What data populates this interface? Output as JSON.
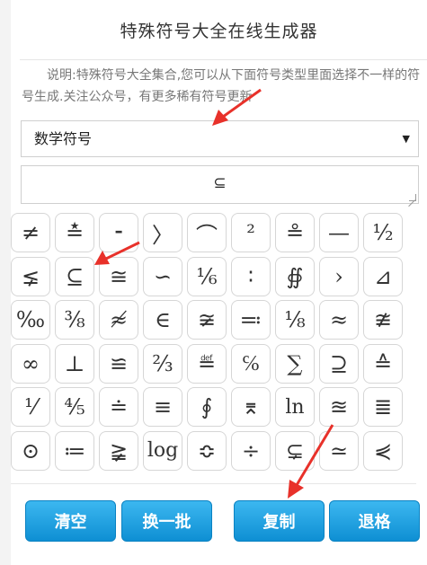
{
  "title": "特殊符号大全在线生成器",
  "description": "说明:特殊符号大全集合,您可以从下面符号类型里面选择不一样的符号生成.关注公众号，有更多稀有符号更新",
  "select": {
    "selected": "数学符号",
    "arrow": "▼"
  },
  "output": {
    "value": "⊆"
  },
  "symbols": [
    "≠",
    "≛",
    "⁃",
    "〉",
    "⌒",
    "²",
    "≗",
    "—",
    "½",
    "⪇",
    "⊆",
    "≅",
    "∽",
    "⅙",
    "∶",
    "∯",
    "›",
    "⊿",
    "‰",
    "⅜",
    "≉",
    "∈",
    "≆",
    "≕",
    "⅛",
    "≈",
    "≇",
    "∞",
    "⊥",
    "≌",
    "⅔",
    "≝",
    "℅",
    "∑",
    "⊇",
    "≙",
    "⅟",
    "⅘",
    "≐",
    "≡",
    "∮",
    "⌆",
    "ln",
    "≊",
    "≣",
    "⊙",
    "≔",
    "≩",
    "log",
    "≎",
    "÷",
    "⊊",
    "≃",
    "⋞"
  ],
  "buttons": {
    "clear": "清空",
    "next_batch": "换一批",
    "copy": "复制",
    "backspace": "退格"
  },
  "colors": {
    "button_gradient_top": "#3cb7f0",
    "button_gradient_bottom": "#0e8fd3",
    "annotation_arrow": "#e8312a"
  }
}
